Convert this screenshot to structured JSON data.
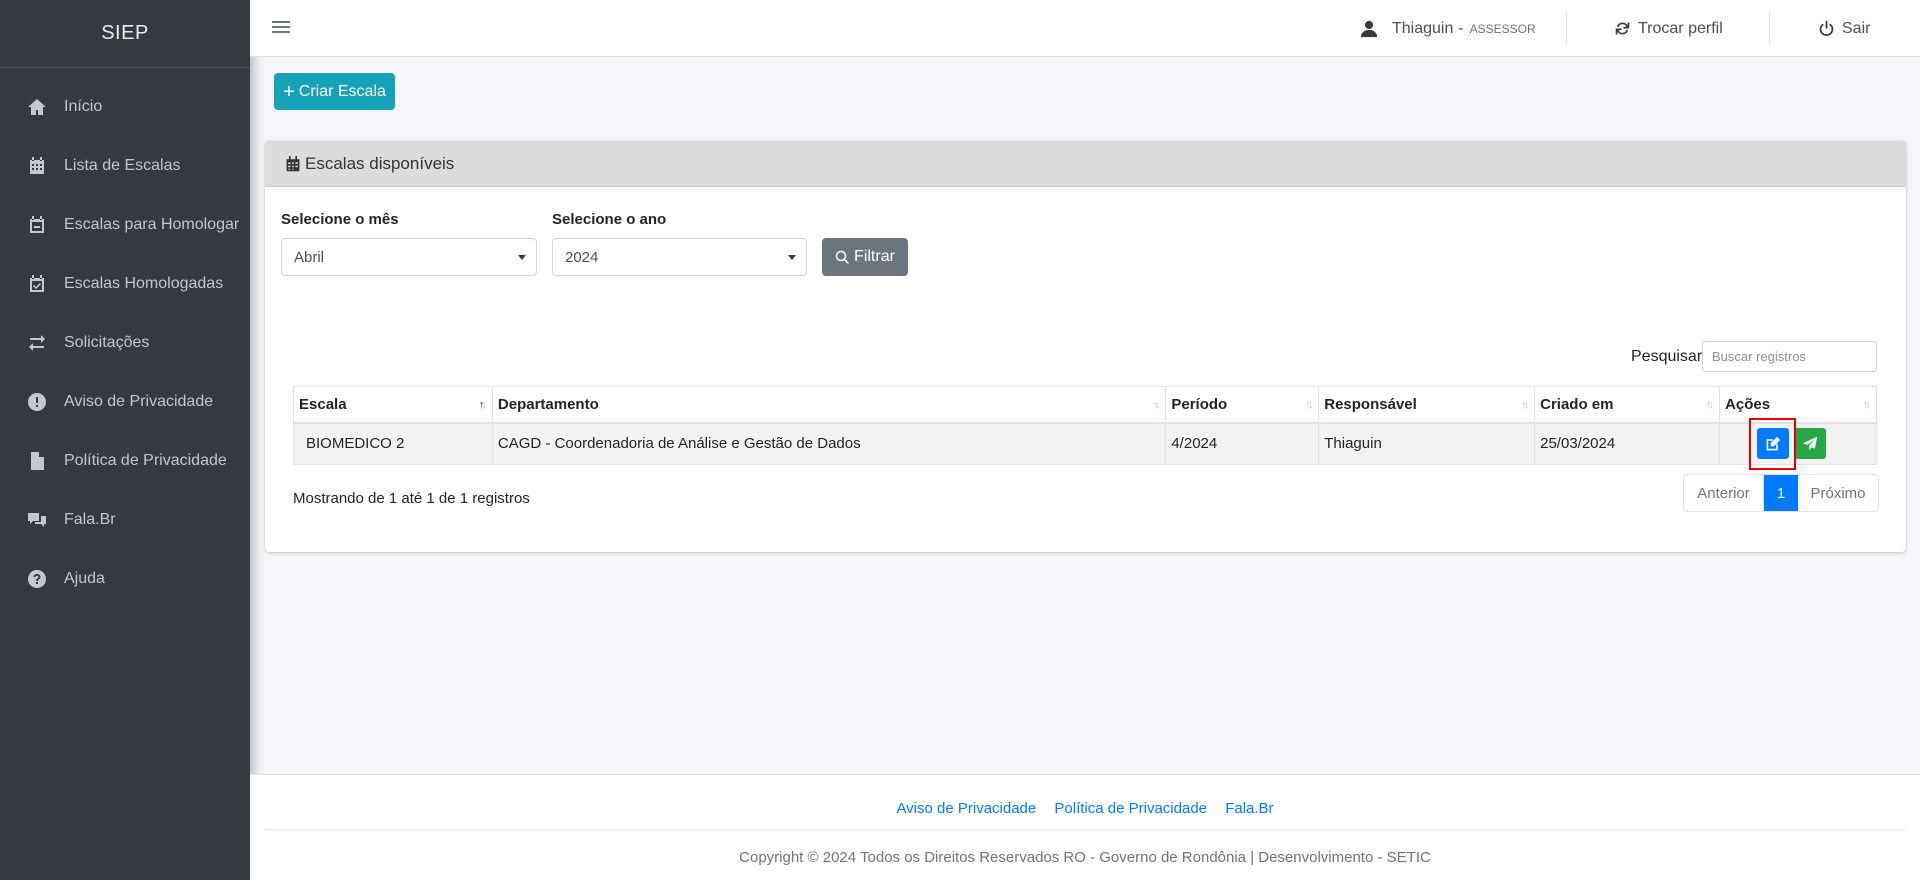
{
  "app": {
    "brand": "SIEP"
  },
  "sidebar": {
    "items": [
      {
        "label": "Início",
        "icon": "home-icon"
      },
      {
        "label": "Lista de Escalas",
        "icon": "calendar-icon"
      },
      {
        "label": "Escalas para Homologar",
        "icon": "calendar-minus-icon"
      },
      {
        "label": "Escalas Homologadas",
        "icon": "calendar-check-icon"
      },
      {
        "label": "Solicitações",
        "icon": "exchange-icon"
      },
      {
        "label": "Aviso de Privacidade",
        "icon": "exclamation-circle-icon"
      },
      {
        "label": "Política de Privacidade",
        "icon": "file-icon"
      },
      {
        "label": "Fala.Br",
        "icon": "comments-icon"
      },
      {
        "label": "Ajuda",
        "icon": "question-circle-icon"
      }
    ]
  },
  "header": {
    "user_name": "Thiaguin - ",
    "user_role": "ASSESSOR",
    "switch_profile": "Trocar perfil",
    "logout": "Sair"
  },
  "actions": {
    "create_label": "Criar Escala"
  },
  "card": {
    "title": "Escalas disponíveis",
    "filters": {
      "month_label": "Selecione o mês",
      "month_value": "Abril",
      "year_label": "Selecione o ano",
      "year_value": "2024",
      "filter_button": "Filtrar"
    },
    "search": {
      "label": "Pesquisar",
      "placeholder": "Buscar registros"
    },
    "table": {
      "columns": [
        "Escala",
        "Departamento",
        "Período",
        "Responsável",
        "Criado em",
        "Ações"
      ],
      "rows": [
        {
          "escala": "BIOMEDICO 2",
          "departamento": "CAGD - Coordenadoria de Análise e Gestão de Dados",
          "periodo": "4/2024",
          "responsavel": "Thiaguin",
          "criado_em": "25/03/2024"
        }
      ]
    },
    "info": "Mostrando de 1 até 1 de 1 registros",
    "pagination": {
      "prev": "Anterior",
      "current": "1",
      "next": "Próximo"
    }
  },
  "footer": {
    "links": [
      "Aviso de Privacidade",
      "Política de Privacidade",
      "Fala.Br"
    ],
    "copyright": "Copyright © 2024 Todos os Direitos Reservados RO - Governo de Rondônia | Desenvolvimento - SETIC"
  },
  "colors": {
    "sidebar_bg": "#343a40",
    "create_button": "#17a2b8",
    "primary": "#007bff",
    "success": "#28a745",
    "secondary": "#6c757d",
    "highlight": "#e00000"
  }
}
